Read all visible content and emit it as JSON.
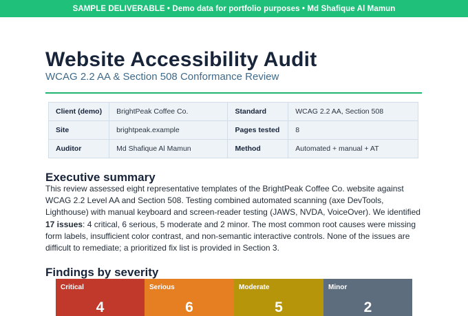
{
  "banner": {
    "text": "SAMPLE DELIVERABLE  •  Demo data for portfolio purposes  •  Md Shafique Al Mamun"
  },
  "header": {
    "title": "Website Accessibility Audit",
    "subtitle": "WCAG 2.2 AA & Section 508 Conformance Review"
  },
  "meta": {
    "rows": [
      [
        {
          "key": "Client (demo)",
          "value": "BrightPeak Coffee Co."
        },
        {
          "key": "Standard",
          "value": "WCAG 2.2 AA, Section 508"
        }
      ],
      [
        {
          "key": "Site",
          "value": "brightpeak.example"
        },
        {
          "key": "Pages tested",
          "value": "8"
        }
      ],
      [
        {
          "key": "Auditor",
          "value": "Md Shafique Al Mamun"
        },
        {
          "key": "Method",
          "value": "Automated + manual + AT"
        }
      ]
    ]
  },
  "executive_summary": {
    "heading": "Executive summary",
    "text_before": "This review assessed eight representative templates of the BrightPeak Coffee Co. website against WCAG 2.2 Level AA and Section 508. Testing combined automated scanning (axe DevTools, Lighthouse) with manual keyboard and screen-reader testing (JAWS, NVDA, VoiceOver). We identified ",
    "highlight": "17 issues",
    "text_after": ": 4 critical, 6 serious, 5 moderate and 2 minor. The most common root causes were missing form labels, insufficient color contrast, and non-semantic interactive controls. None of the issues are difficult to remediate; a prioritized fix list is provided in Section 3."
  },
  "findings": {
    "heading": "Findings by severity",
    "severities": [
      {
        "label": "Critical",
        "count": "4",
        "color": "#c0392b"
      },
      {
        "label": "Serious",
        "count": "6",
        "color": "#e67e22"
      },
      {
        "label": "Moderate",
        "count": "5",
        "color": "#b7950b"
      },
      {
        "label": "Minor",
        "count": "2",
        "color": "#5d6d7e"
      }
    ]
  },
  "colors": {
    "banner": "#1fc07a",
    "title": "#17243a",
    "subtitle": "#3f6a8a",
    "rule": "#1fb36f",
    "table_bg": "#eef3f8"
  }
}
